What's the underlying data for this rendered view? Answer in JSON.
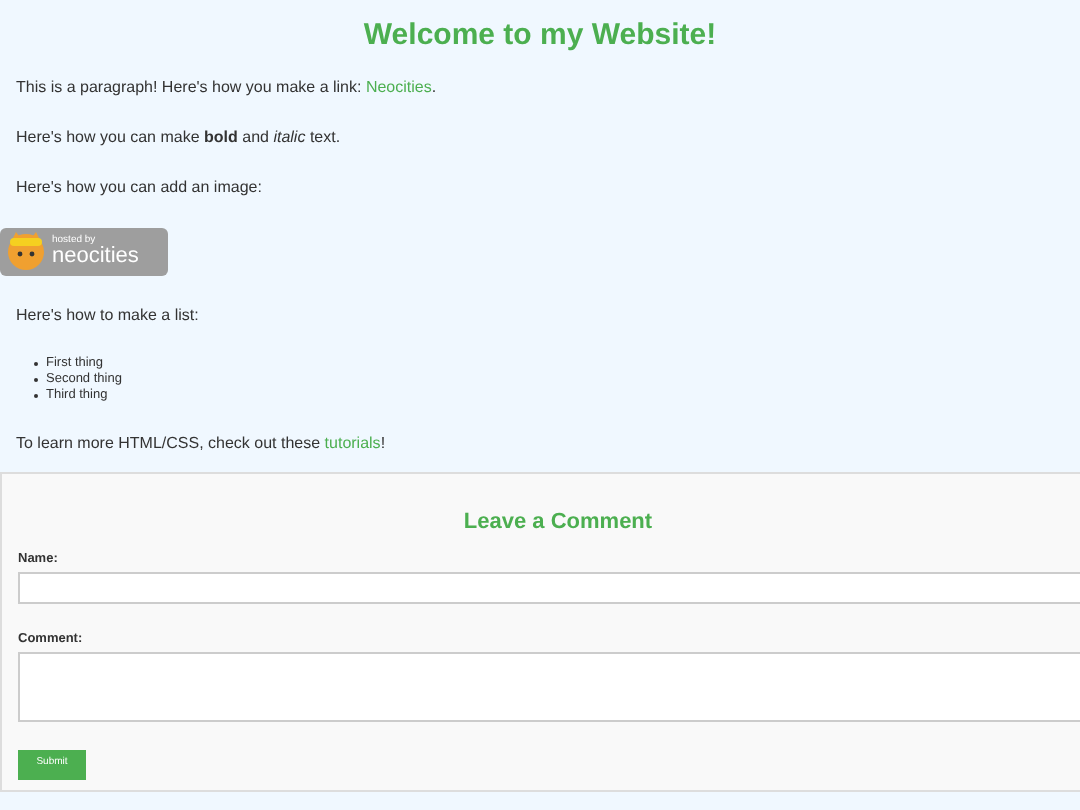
{
  "title": "Welcome to my Website!",
  "content": [
    {
      "kind": "text",
      "text": "This is a paragraph! Here's how you make a link: ",
      "link": "Neocities",
      "after": "."
    },
    {
      "kind": "text",
      "text": "Here's how you can make **bold** and *italic* text."
    },
    {
      "kind": "text",
      "text": "Here's how you can add an image:"
    },
    {
      "kind": "badge",
      "small": "hosted by",
      "big": "neocities"
    },
    {
      "kind": "text",
      "text": "Here's how to make a list:"
    },
    {
      "kind": "list",
      "items": [
        "First thing",
        "Second thing",
        "Third thing"
      ]
    },
    {
      "kind": "text",
      "text": "To learn more HTML/CSS, check out these ",
      "link": "tutorials",
      "after": "!"
    }
  ],
  "form": {
    "heading": "Leave a Comment",
    "name_label": "Name:",
    "comment_label": "Comment:",
    "submit": "Submit"
  }
}
